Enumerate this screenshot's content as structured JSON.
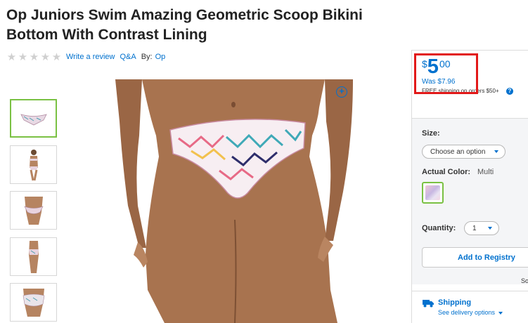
{
  "product": {
    "title": "Op Juniors Swim Amazing Geometric Scoop Bikini Bottom With Contrast Lining",
    "rating_stars": 0,
    "write_review": "Write a review",
    "qa": "Q&A",
    "by_label": "By:",
    "brand": "Op"
  },
  "price": {
    "currency": "$",
    "dollars": "5",
    "cents": "00",
    "was": "Was $7.96",
    "shipping_note": "FREE shipping on orders $50+"
  },
  "options": {
    "size_label": "Size:",
    "size_value": "Choose an option",
    "color_label": "Actual Color:",
    "color_value": "Multi",
    "quantity_label": "Quantity:",
    "quantity_value": "1"
  },
  "actions": {
    "registry": "Add to Registry",
    "cut_text": "So"
  },
  "shipping": {
    "title": "Shipping",
    "link": "See delivery options"
  },
  "colors": {
    "accent": "#0071ce",
    "highlight_border": "#e21919",
    "selected_green": "#7ac143"
  },
  "icons": [
    "star-icon",
    "zoom-plus-icon",
    "help-icon",
    "chevron-down-icon",
    "truck-icon"
  ]
}
